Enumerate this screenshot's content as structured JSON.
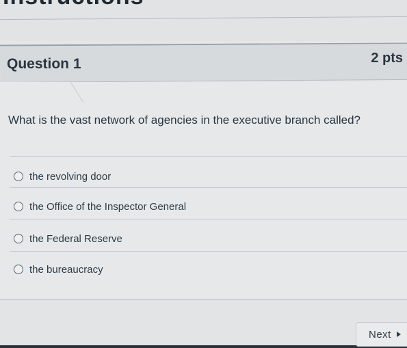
{
  "header": {
    "cut_heading": "Instructions"
  },
  "question": {
    "title": "Question 1",
    "points": "2 pts",
    "text": "What is the vast network of agencies in the executive branch called?"
  },
  "answers": [
    {
      "label": "the revolving door",
      "selected": false
    },
    {
      "label": "the Office of the Inspector General",
      "selected": false
    },
    {
      "label": "the Federal Reserve",
      "selected": false
    },
    {
      "label": "the bureaucracy",
      "selected": false
    }
  ],
  "footer": {
    "next_label": "Next",
    "next_icon": "caret-right-icon"
  }
}
